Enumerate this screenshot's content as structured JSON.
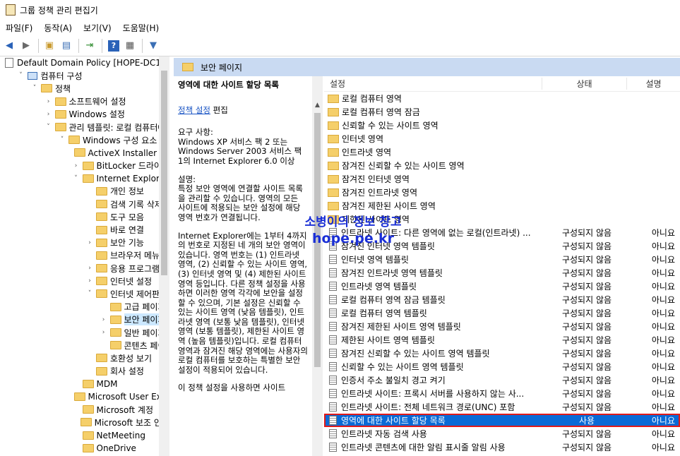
{
  "window": {
    "title": "그룹 정책 관리 편집기"
  },
  "menu": [
    {
      "label": "파일(F)"
    },
    {
      "label": "동작(A)"
    },
    {
      "label": "보기(V)"
    },
    {
      "label": "도움말(H)"
    }
  ],
  "tree": [
    {
      "label": "Default Domain Policy [HOPE-DC1.H",
      "indent": 0,
      "chev": "",
      "icon": "doc"
    },
    {
      "label": "컴퓨터 구성",
      "indent": 1,
      "chev": "˅",
      "icon": "pc"
    },
    {
      "label": "정책",
      "indent": 2,
      "chev": "˅",
      "icon": "folder"
    },
    {
      "label": "소프트웨어 설정",
      "indent": 3,
      "chev": "›",
      "icon": "folder"
    },
    {
      "label": "Windows 설정",
      "indent": 3,
      "chev": "›",
      "icon": "folder"
    },
    {
      "label": "관리 템플릿: 로컬 컴퓨터에",
      "indent": 3,
      "chev": "˅",
      "icon": "folder"
    },
    {
      "label": "Windows 구성 요소",
      "indent": 4,
      "chev": "˅",
      "icon": "folder"
    },
    {
      "label": "ActiveX Installer 서비",
      "indent": 5,
      "chev": "",
      "icon": "folder"
    },
    {
      "label": "BitLocker 드라이브",
      "indent": 5,
      "chev": "›",
      "icon": "folder"
    },
    {
      "label": "Internet Explorer",
      "indent": 5,
      "chev": "˅",
      "icon": "folder"
    },
    {
      "label": "개인 정보",
      "indent": 6,
      "chev": "",
      "icon": "folder"
    },
    {
      "label": "검색 기록 삭제",
      "indent": 6,
      "chev": "",
      "icon": "folder"
    },
    {
      "label": "도구 모음",
      "indent": 6,
      "chev": "",
      "icon": "folder"
    },
    {
      "label": "바로 연결",
      "indent": 6,
      "chev": "",
      "icon": "folder"
    },
    {
      "label": "보안 기능",
      "indent": 6,
      "chev": "›",
      "icon": "folder"
    },
    {
      "label": "브라우저 메뉴",
      "indent": 6,
      "chev": "",
      "icon": "folder"
    },
    {
      "label": "응용 프로그램 3",
      "indent": 6,
      "chev": "›",
      "icon": "folder"
    },
    {
      "label": "인터넷 설정",
      "indent": 6,
      "chev": "›",
      "icon": "folder"
    },
    {
      "label": "인터넷 제어판",
      "indent": 6,
      "chev": "˅",
      "icon": "folder"
    },
    {
      "label": "고급 페이지",
      "indent": 7,
      "chev": "",
      "icon": "folder"
    },
    {
      "label": "보안 페이지",
      "indent": 7,
      "chev": "›",
      "icon": "folder",
      "selected": true
    },
    {
      "label": "일반 페이지",
      "indent": 7,
      "chev": "›",
      "icon": "folder"
    },
    {
      "label": "콘텐츠 페이",
      "indent": 7,
      "chev": "",
      "icon": "folder"
    },
    {
      "label": "호환성 보기",
      "indent": 6,
      "chev": "",
      "icon": "folder"
    },
    {
      "label": "회사 설정",
      "indent": 6,
      "chev": "",
      "icon": "folder"
    },
    {
      "label": "MDM",
      "indent": 5,
      "chev": "",
      "icon": "folder"
    },
    {
      "label": "Microsoft User Expe",
      "indent": 5,
      "chev": "",
      "icon": "folder"
    },
    {
      "label": "Microsoft 계정",
      "indent": 5,
      "chev": "",
      "icon": "folder"
    },
    {
      "label": "Microsoft 보조 인증",
      "indent": 5,
      "chev": "",
      "icon": "folder"
    },
    {
      "label": "NetMeeting",
      "indent": 5,
      "chev": "",
      "icon": "folder"
    },
    {
      "label": "OneDrive",
      "indent": 5,
      "chev": "",
      "icon": "folder"
    }
  ],
  "rightHeader": "보안 페이지",
  "description": {
    "title": "영역에 대한 사이트 할당 목록",
    "link": "정책 설정",
    "link_suffix": " 편집",
    "requirements": "요구 사항:\nWindows XP 서비스 팩 2 또는 Windows Server 2003 서비스 팩 1의 Internet Explorer 6.0 이상",
    "summary": "설명:\n특정 보안 영역에 연결할 사이트 목록을 관리할 수 있습니다. 영역의 모든 사이트에 적용되는 보안 설정에 해당 영역 번호가 연결됩니다.",
    "body": "Internet Explorer에는 1부터 4까지의 번호로 지정된 네 개의 보안 영역이 있습니다. 영역 번호는 (1) 인트라넷 영역, (2) 신뢰할 수 있는 사이트 영역, (3) 인터넷 영역 및 (4) 제한된 사이트 영역 등입니다. 다른 정책 설정을 사용하면 이러한 영역 각각에 보안을 설정할 수 있으며, 기본 설정은 신뢰할 수 있는 사이트 영역 (낮음 템플릿), 인트라넷 영역 (보통 낮음 템플릿), 인터넷 영역 (보통 템플릿), 제한된 사이트 영역 (높음 템플릿)입니다. 로컬 컴퓨터 영역과 잠겨진 해당 영역에는 사용자의 로컬 컴퓨터를 보호하는 특별한 보안 설정이 적용되어 있습니다.",
    "tail": "이 정책 설정을 사용하면 사이트"
  },
  "list": {
    "headers": {
      "name": "설정",
      "state": "상태",
      "comment": "설명"
    },
    "rows": [
      {
        "name": "로컬 컴퓨터 영역",
        "state": "",
        "comment": "",
        "type": "folder"
      },
      {
        "name": "로컬 컴퓨터 영역 잠금",
        "state": "",
        "comment": "",
        "type": "folder"
      },
      {
        "name": "신뢰할 수 있는 사이트 영역",
        "state": "",
        "comment": "",
        "type": "folder"
      },
      {
        "name": "인터넷 영역",
        "state": "",
        "comment": "",
        "type": "folder"
      },
      {
        "name": "인트라넷 영역",
        "state": "",
        "comment": "",
        "type": "folder"
      },
      {
        "name": "잠겨진 신뢰할 수 있는 사이트 영역",
        "state": "",
        "comment": "",
        "type": "folder"
      },
      {
        "name": "잠겨진 인터넷 영역",
        "state": "",
        "comment": "",
        "type": "folder"
      },
      {
        "name": "잠겨진 인트라넷 영역",
        "state": "",
        "comment": "",
        "type": "folder"
      },
      {
        "name": "잠겨진 제한된 사이트 영역",
        "state": "",
        "comment": "",
        "type": "folder"
      },
      {
        "name": "제한된 사이트 영역",
        "state": "",
        "comment": "",
        "type": "folder"
      },
      {
        "name": "인트라넷 사이트: 다른 영역에 없는 로컬(인트라넷) ...",
        "state": "구성되지 않음",
        "comment": "아니요",
        "type": "setting"
      },
      {
        "name": "잠겨진 인터넷 영역 템플릿",
        "state": "구성되지 않음",
        "comment": "아니요",
        "type": "setting"
      },
      {
        "name": "인터넷 영역 템플릿",
        "state": "구성되지 않음",
        "comment": "아니요",
        "type": "setting"
      },
      {
        "name": "잠겨진 인트라넷 영역 템플릿",
        "state": "구성되지 않음",
        "comment": "아니요",
        "type": "setting"
      },
      {
        "name": "인트라넷 영역 템플릿",
        "state": "구성되지 않음",
        "comment": "아니요",
        "type": "setting"
      },
      {
        "name": "로컬 컴퓨터 영역 잠금 템플릿",
        "state": "구성되지 않음",
        "comment": "아니요",
        "type": "setting"
      },
      {
        "name": "로컬 컴퓨터 영역 템플릿",
        "state": "구성되지 않음",
        "comment": "아니요",
        "type": "setting"
      },
      {
        "name": "잠겨진 제한된 사이트 영역 템플릿",
        "state": "구성되지 않음",
        "comment": "아니요",
        "type": "setting"
      },
      {
        "name": "제한된 사이트 영역 템플릿",
        "state": "구성되지 않음",
        "comment": "아니요",
        "type": "setting"
      },
      {
        "name": "잠겨진 신뢰할 수 있는 사이트 영역 템플릿",
        "state": "구성되지 않음",
        "comment": "아니요",
        "type": "setting"
      },
      {
        "name": "신뢰할 수 있는 사이트 영역 템플릿",
        "state": "구성되지 않음",
        "comment": "아니요",
        "type": "setting"
      },
      {
        "name": "인증서 주소 불일치 경고 켜기",
        "state": "구성되지 않음",
        "comment": "아니요",
        "type": "setting"
      },
      {
        "name": "인트라넷 사이트: 프록시 서버를 사용하지 않는 사...",
        "state": "구성되지 않음",
        "comment": "아니요",
        "type": "setting"
      },
      {
        "name": "인트라넷 사이트: 전체 네트워크 경로(UNC) 포함",
        "state": "구성되지 않음",
        "comment": "아니요",
        "type": "setting"
      },
      {
        "name": "영역에 대한 사이트 할당 목록",
        "state": "사용",
        "comment": "아니요",
        "type": "setting",
        "selected": true
      },
      {
        "name": "인트라넷 자동 검색 사용",
        "state": "구성되지 않음",
        "comment": "아니요",
        "type": "setting"
      },
      {
        "name": "인트라넷 콘텐츠에 대한 알림 표시줄 알림 사용",
        "state": "구성되지 않음",
        "comment": "아니요",
        "type": "setting"
      }
    ]
  },
  "watermark": {
    "line1": "소병이의 정보 창고",
    "line2": "hope.pe.kr"
  }
}
